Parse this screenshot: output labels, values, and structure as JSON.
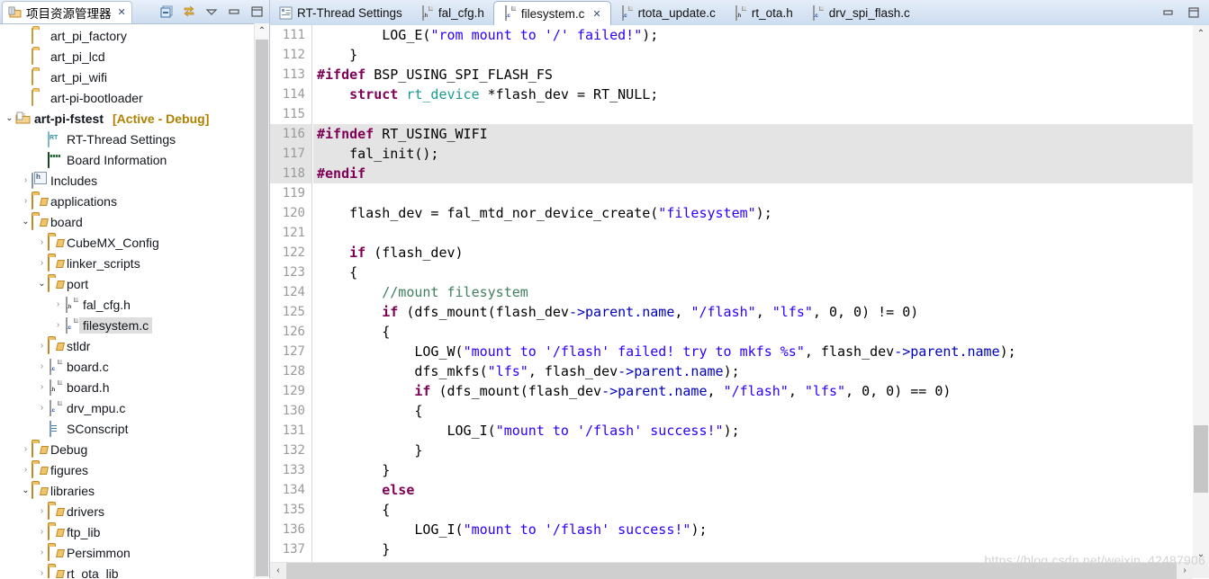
{
  "explorer": {
    "tab_label": "项目资源管理器",
    "tab_close": "✕",
    "toolbar": [
      {
        "name": "collapse-all-icon",
        "label": "⊟"
      },
      {
        "name": "link-with-editor-icon",
        "label": "⇄"
      },
      {
        "name": "view-menu-icon",
        "label": "▽"
      },
      {
        "name": "minimize-icon",
        "label": "▭"
      },
      {
        "name": "maximize-icon",
        "label": "❐"
      }
    ],
    "items": [
      {
        "label": "art_pi_factory",
        "icon": "folder-icon",
        "indent": 1,
        "arrow": "",
        "bold": false
      },
      {
        "label": "art_pi_lcd",
        "icon": "folder-icon",
        "indent": 1,
        "arrow": "",
        "bold": false
      },
      {
        "label": "art_pi_wifi",
        "icon": "folder-icon",
        "indent": 1,
        "arrow": "",
        "bold": false
      },
      {
        "label": "art-pi-bootloader",
        "icon": "folder-icon",
        "indent": 1,
        "arrow": "",
        "bold": false
      },
      {
        "label": "art-pi-fstest",
        "suffix": "[Active - Debug]",
        "icon": "project-icon",
        "indent": 0,
        "arrow": "v",
        "bold": true
      },
      {
        "label": "RT-Thread Settings",
        "icon": "rt-thread-icon",
        "indent": 2,
        "arrow": "",
        "bold": false
      },
      {
        "label": "Board Information",
        "icon": "board-info-icon",
        "indent": 2,
        "arrow": "",
        "bold": false
      },
      {
        "label": "Includes",
        "icon": "includes-icon",
        "indent": 1,
        "arrow": ">",
        "bold": false
      },
      {
        "label": "applications",
        "icon": "source-folder-icon",
        "indent": 1,
        "arrow": ">",
        "bold": false
      },
      {
        "label": "board",
        "icon": "source-folder-icon",
        "indent": 1,
        "arrow": "v",
        "bold": false
      },
      {
        "label": "CubeMX_Config",
        "icon": "source-folder-icon",
        "indent": 2,
        "arrow": ">",
        "bold": false
      },
      {
        "label": "linker_scripts",
        "icon": "source-folder-icon",
        "indent": 2,
        "arrow": ">",
        "bold": false
      },
      {
        "label": "port",
        "icon": "source-folder-icon",
        "indent": 2,
        "arrow": "v",
        "bold": false
      },
      {
        "label": "fal_cfg.h",
        "icon": "h-file-icon",
        "indent": 3,
        "arrow": ">",
        "bold": false
      },
      {
        "label": "filesystem.c",
        "icon": "c-file-icon",
        "indent": 3,
        "arrow": ">",
        "bold": false,
        "selected": true
      },
      {
        "label": "stldr",
        "icon": "source-folder-icon",
        "indent": 2,
        "arrow": ">",
        "bold": false
      },
      {
        "label": "board.c",
        "icon": "c-file-icon",
        "indent": 2,
        "arrow": ">",
        "bold": false
      },
      {
        "label": "board.h",
        "icon": "h-file-icon",
        "indent": 2,
        "arrow": ">",
        "bold": false
      },
      {
        "label": "drv_mpu.c",
        "icon": "c-file-icon",
        "indent": 2,
        "arrow": ">",
        "bold": false
      },
      {
        "label": "SConscript",
        "icon": "sconscript-icon",
        "indent": 2,
        "arrow": "",
        "bold": false
      },
      {
        "label": "Debug",
        "icon": "source-folder-icon",
        "indent": 1,
        "arrow": ">",
        "bold": false
      },
      {
        "label": "figures",
        "icon": "source-folder-icon",
        "indent": 1,
        "arrow": ">",
        "bold": false
      },
      {
        "label": "libraries",
        "icon": "source-folder-icon",
        "indent": 1,
        "arrow": "v",
        "bold": false
      },
      {
        "label": "drivers",
        "icon": "source-folder-icon",
        "indent": 2,
        "arrow": ">",
        "bold": false
      },
      {
        "label": "ftp_lib",
        "icon": "source-folder-icon",
        "indent": 2,
        "arrow": ">",
        "bold": false
      },
      {
        "label": "Persimmon",
        "icon": "source-folder-icon",
        "indent": 2,
        "arrow": ">",
        "bold": false
      },
      {
        "label": "rt_ota_lib",
        "icon": "source-folder-icon",
        "indent": 2,
        "arrow": ">",
        "bold": false
      }
    ]
  },
  "editor": {
    "tabs": [
      {
        "label": "RT-Thread Settings",
        "icon": "settings-icon",
        "active": false,
        "closable": false
      },
      {
        "label": "fal_cfg.h",
        "icon": "h-file-icon",
        "active": false,
        "closable": false
      },
      {
        "label": "filesystem.c",
        "icon": "c-file-icon",
        "active": true,
        "closable": true,
        "close": "✕"
      },
      {
        "label": "rtota_update.c",
        "icon": "c-file-icon",
        "active": false,
        "closable": false
      },
      {
        "label": "rt_ota.h",
        "icon": "h-file-icon",
        "active": false,
        "closable": false
      },
      {
        "label": "drv_spi_flash.c",
        "icon": "c-file-icon",
        "active": false,
        "closable": false
      }
    ],
    "window_controls": [
      {
        "name": "minimize-icon",
        "label": "▭"
      },
      {
        "name": "maximize-icon",
        "label": "❐"
      }
    ],
    "first_line_number": 111,
    "lines": [
      {
        "n": 111,
        "hl": false,
        "text": "        LOG_E(\"rom mount to '/' failed!\");"
      },
      {
        "n": 112,
        "hl": false,
        "text": "    }"
      },
      {
        "n": 113,
        "hl": false,
        "text": "#ifdef BSP_USING_SPI_FLASH_FS"
      },
      {
        "n": 114,
        "hl": false,
        "text": "    struct rt_device *flash_dev = RT_NULL;"
      },
      {
        "n": 115,
        "hl": false,
        "text": ""
      },
      {
        "n": 116,
        "hl": true,
        "text": "#ifndef RT_USING_WIFI"
      },
      {
        "n": 117,
        "hl": true,
        "text": "    fal_init();"
      },
      {
        "n": 118,
        "hl": true,
        "text": "#endif"
      },
      {
        "n": 119,
        "hl": false,
        "text": ""
      },
      {
        "n": 120,
        "hl": false,
        "text": "    flash_dev = fal_mtd_nor_device_create(\"filesystem\");"
      },
      {
        "n": 121,
        "hl": false,
        "text": ""
      },
      {
        "n": 122,
        "hl": false,
        "text": "    if (flash_dev)"
      },
      {
        "n": 123,
        "hl": false,
        "text": "    {"
      },
      {
        "n": 124,
        "hl": false,
        "text": "        //mount filesystem"
      },
      {
        "n": 125,
        "hl": false,
        "text": "        if (dfs_mount(flash_dev->parent.name, \"/flash\", \"lfs\", 0, 0) != 0)"
      },
      {
        "n": 126,
        "hl": false,
        "text": "        {"
      },
      {
        "n": 127,
        "hl": false,
        "text": "            LOG_W(\"mount to '/flash' failed! try to mkfs %s\", flash_dev->parent.name);"
      },
      {
        "n": 128,
        "hl": false,
        "text": "            dfs_mkfs(\"lfs\", flash_dev->parent.name);"
      },
      {
        "n": 129,
        "hl": false,
        "text": "            if (dfs_mount(flash_dev->parent.name, \"/flash\", \"lfs\", 0, 0) == 0)"
      },
      {
        "n": 130,
        "hl": false,
        "text": "            {"
      },
      {
        "n": 131,
        "hl": false,
        "text": "                LOG_I(\"mount to '/flash' success!\");"
      },
      {
        "n": 132,
        "hl": false,
        "text": "            }"
      },
      {
        "n": 133,
        "hl": false,
        "text": "        }"
      },
      {
        "n": 134,
        "hl": false,
        "text": "        else"
      },
      {
        "n": 135,
        "hl": false,
        "text": "        {"
      },
      {
        "n": 136,
        "hl": false,
        "text": "            LOG_I(\"mount to '/flash' success!\");"
      },
      {
        "n": 137,
        "hl": false,
        "text": "        }"
      }
    ],
    "scrollbar": {
      "up_arrow": "⌃",
      "down_arrow": "⌄",
      "left_arrow": "‹",
      "right_arrow": "›"
    }
  },
  "watermark": "https://blog.csdn.net/weixin_42487906",
  "colors": {
    "keyword": "#7f0055",
    "string": "#2a00ff",
    "comment": "#3f7f5f",
    "type": "#1a9b8f",
    "field": "#0000c0",
    "highlight_line": "#e4e4e4",
    "tabbar": "#ccdcf0",
    "active_debug": "#b08000"
  }
}
